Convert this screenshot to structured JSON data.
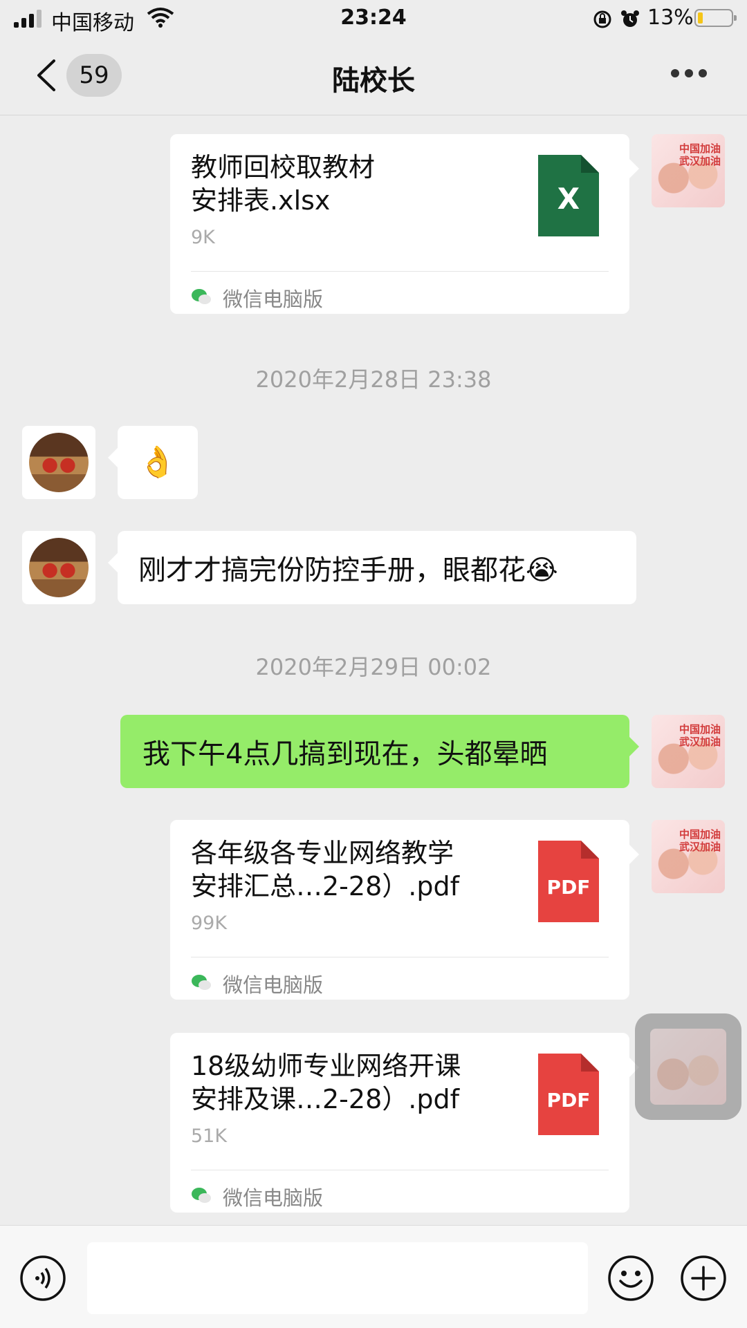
{
  "status_bar": {
    "carrier": "中国移动",
    "time": "23:24",
    "battery_percent": "13%",
    "battery_level": 0.13,
    "icons": [
      "signal-icon",
      "wifi-icon",
      "rotation-lock-icon",
      "alarm-icon",
      "battery-icon"
    ]
  },
  "nav": {
    "back_icon": "chevron-left-icon",
    "unread_count": "59",
    "title": "陆校长",
    "more_icon": "more-dots-icon"
  },
  "avatars": {
    "self_text": "中国加油 武汉加油"
  },
  "messages": [
    {
      "type": "file",
      "side": "right",
      "name": "教师回校取教材安排表.xlsx",
      "name_line1": "教师回校取教材",
      "name_line2": "安排表.xlsx",
      "size": "9K",
      "file_type": "X",
      "icon_color": "#1f7244",
      "source": "微信电脑版"
    },
    {
      "type": "timestamp",
      "text": "2020年2月28日 23:38"
    },
    {
      "type": "emoji",
      "side": "left",
      "emoji": "👌"
    },
    {
      "type": "text",
      "side": "left",
      "text": "刚才才搞完份防控手册，眼都花😭"
    },
    {
      "type": "timestamp",
      "text": "2020年2月29日 00:02"
    },
    {
      "type": "text",
      "side": "right",
      "text": "我下午4点几搞到现在，头都晕晒"
    },
    {
      "type": "file",
      "side": "right",
      "name": "各年级各专业网络教学安排汇总…2-28）.pdf",
      "name_line1": "各年级各专业网络教学",
      "name_line2": "安排汇总…2-28）.pdf",
      "size": "99K",
      "file_type": "PDF",
      "icon_color": "#e64340",
      "source": "微信电脑版"
    },
    {
      "type": "file",
      "side": "right",
      "name": "18级幼师专业网络开课安排及课…2-28）.pdf",
      "name_line1": "18级幼师专业网络开课",
      "name_line2": "安排及课…2-28）.pdf",
      "size": "51K",
      "file_type": "PDF",
      "icon_color": "#e64340",
      "source": "微信电脑版"
    }
  ],
  "input_bar": {
    "voice_icon": "voice-icon",
    "emoji_icon": "emoji-icon",
    "plus_icon": "plus-icon",
    "placeholder": ""
  }
}
